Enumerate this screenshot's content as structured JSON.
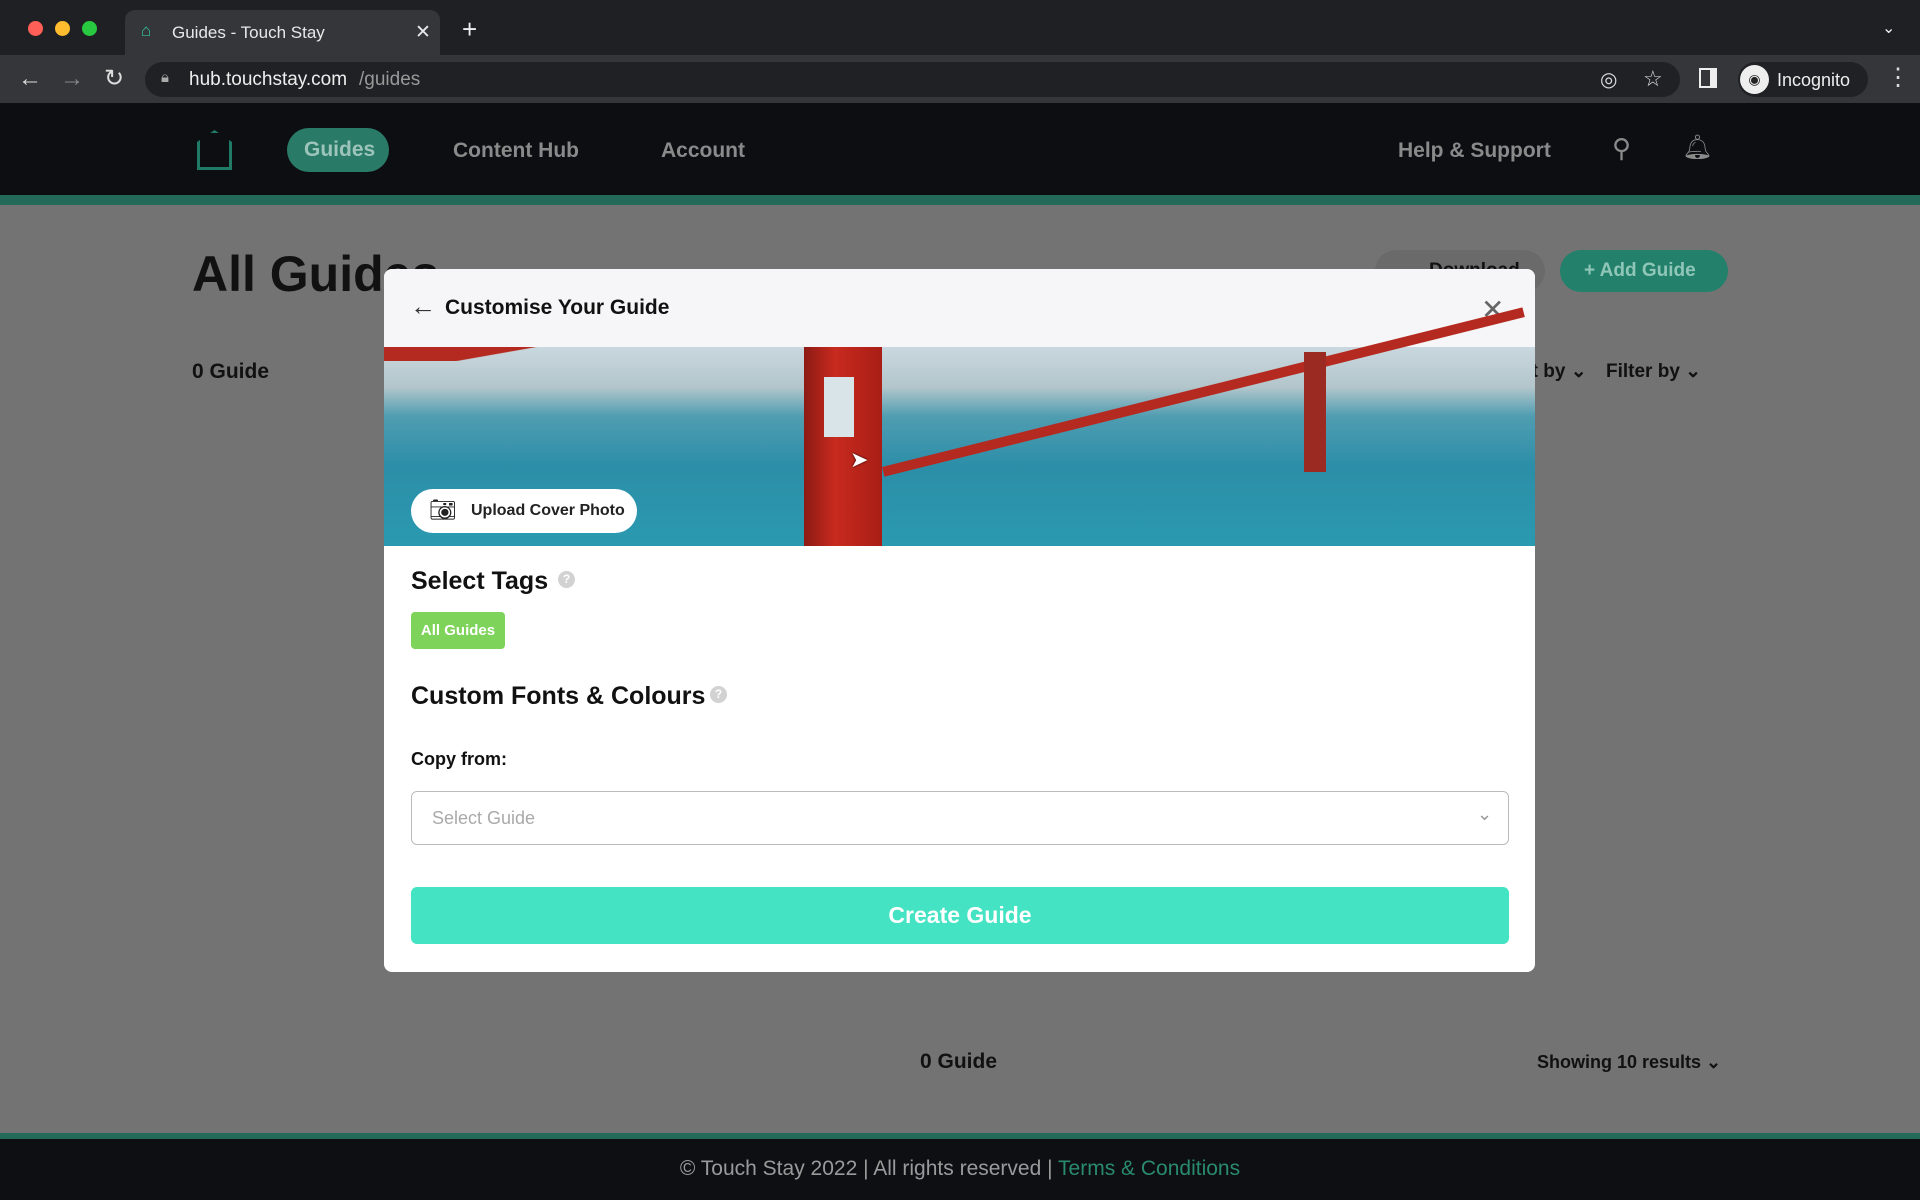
{
  "browser": {
    "tab_title": "Guides - Touch Stay",
    "url_host": "hub.touchstay.com",
    "url_path": "/guides",
    "profile": "Incognito"
  },
  "nav": {
    "items": [
      "Guides",
      "Content Hub",
      "Account"
    ],
    "active": "Guides",
    "help": "Help & Support"
  },
  "page": {
    "title": "All Guides",
    "count": "0 Guide",
    "download": "Download",
    "add_guide": "Add Guide",
    "sort": "Sort by",
    "filter": "Filter by",
    "bottom_count": "0 Guide",
    "showing": "Showing 10 results"
  },
  "modal": {
    "title": "Customise Your Guide",
    "upload": "Upload Cover Photo",
    "tags_heading": "Select Tags",
    "tags": [
      "All Guides"
    ],
    "fonts_heading": "Custom Fonts & Colours",
    "copy_from": "Copy from:",
    "select_placeholder": "Select Guide",
    "create": "Create Guide"
  },
  "footer": {
    "copyright": "© Touch Stay 2022 | All rights reserved |",
    "terms": "Terms & Conditions"
  },
  "colors": {
    "brand": "#2a9a7c",
    "tag": "#7ed35a",
    "create": "#43e3c3"
  }
}
